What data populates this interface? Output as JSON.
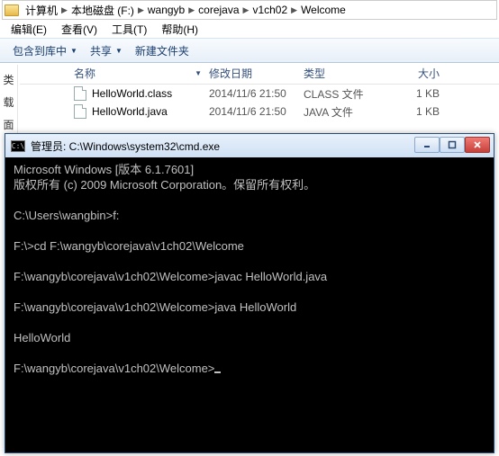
{
  "explorer": {
    "breadcrumb": [
      "计算机",
      "本地磁盘 (F:)",
      "wangyb",
      "corejava",
      "v1ch02",
      "Welcome"
    ],
    "menu": {
      "edit": "编辑(E)",
      "view": "查看(V)",
      "tools": "工具(T)",
      "help": "帮助(H)"
    },
    "toolbar": {
      "include": "包含到库中",
      "share": "共享",
      "newfolder": "新建文件夹"
    },
    "sidebar": [
      "类",
      "载",
      "面"
    ],
    "headers": {
      "name": "名称",
      "modified": "修改日期",
      "type": "类型",
      "size": "大小"
    },
    "files": [
      {
        "name": "HelloWorld.class",
        "modified": "2014/11/6 21:50",
        "type": "CLASS 文件",
        "size": "1 KB"
      },
      {
        "name": "HelloWorld.java",
        "modified": "2014/11/6 21:50",
        "type": "JAVA 文件",
        "size": "1 KB"
      }
    ]
  },
  "console": {
    "title": "管理员: C:\\Windows\\system32\\cmd.exe",
    "icon_text": "C:\\",
    "lines": {
      "l0": "Microsoft Windows [版本 6.1.7601]",
      "l1": "版权所有 (c) 2009 Microsoft Corporation。保留所有权利。",
      "l2": "",
      "l3": "C:\\Users\\wangbin>f:",
      "l4": "",
      "l5": "F:\\>cd F:\\wangyb\\corejava\\v1ch02\\Welcome",
      "l6": "",
      "l7": "F:\\wangyb\\corejava\\v1ch02\\Welcome>javac HelloWorld.java",
      "l8": "",
      "l9": "F:\\wangyb\\corejava\\v1ch02\\Welcome>java HelloWorld",
      "l10": "",
      "l11": "HelloWorld",
      "l12": "",
      "l13": "F:\\wangyb\\corejava\\v1ch02\\Welcome>"
    }
  }
}
